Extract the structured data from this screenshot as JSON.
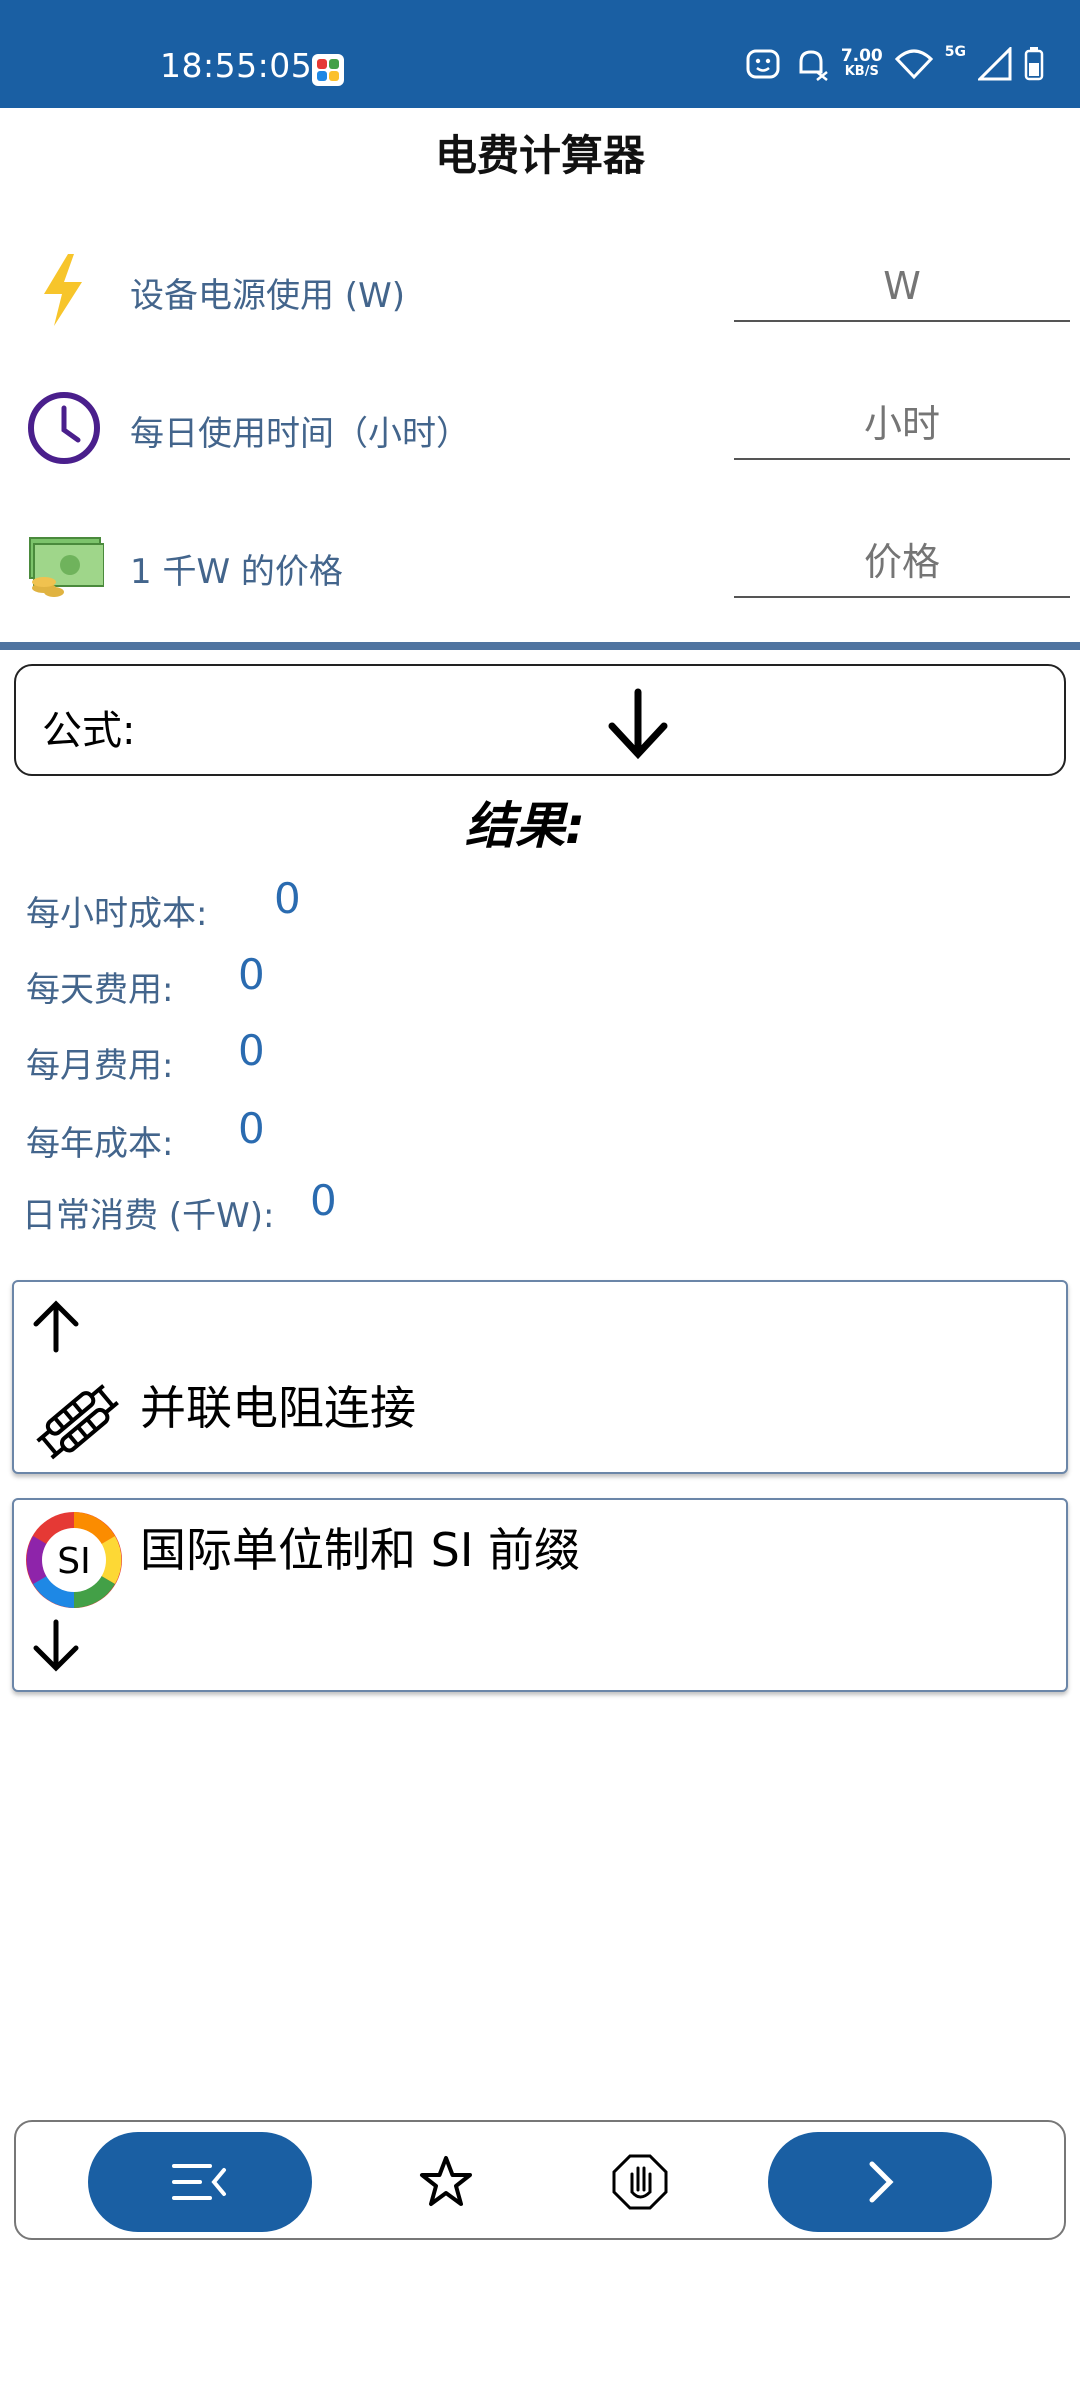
{
  "status_bar": {
    "time": "18:55:05",
    "net_speed_value": "7.00",
    "net_speed_unit": "KB/S",
    "network_type": "5G",
    "background_color": "#1a5fa3"
  },
  "app": {
    "title": "电费计算器"
  },
  "inputs": [
    {
      "label": "设备电源使用 (W)",
      "placeholder": "W",
      "icon": "lightning-icon"
    },
    {
      "label": "每日使用时间（小时）",
      "placeholder": "小时",
      "icon": "clock-icon"
    },
    {
      "label": "1 千W 的价格",
      "placeholder": "价格",
      "icon": "money-icon"
    }
  ],
  "formula": {
    "label": "公式:"
  },
  "results": {
    "title": "结果:",
    "items": [
      {
        "label": "每小时成本:",
        "value": "0"
      },
      {
        "label": "每天费用:",
        "value": "0"
      },
      {
        "label": "每月费用:",
        "value": "0"
      },
      {
        "label": "每年成本:",
        "value": "0"
      },
      {
        "label": "日常消费 (千W):",
        "value": "0"
      }
    ]
  },
  "related": [
    {
      "label": "并联电阻连接",
      "icon": "resistor-icon"
    },
    {
      "label": "国际单位制和 SI 前缀",
      "icon": "si-icon",
      "badge": "SI"
    }
  ],
  "accent_color": "#1a5fa3",
  "label_color": "#43658c"
}
